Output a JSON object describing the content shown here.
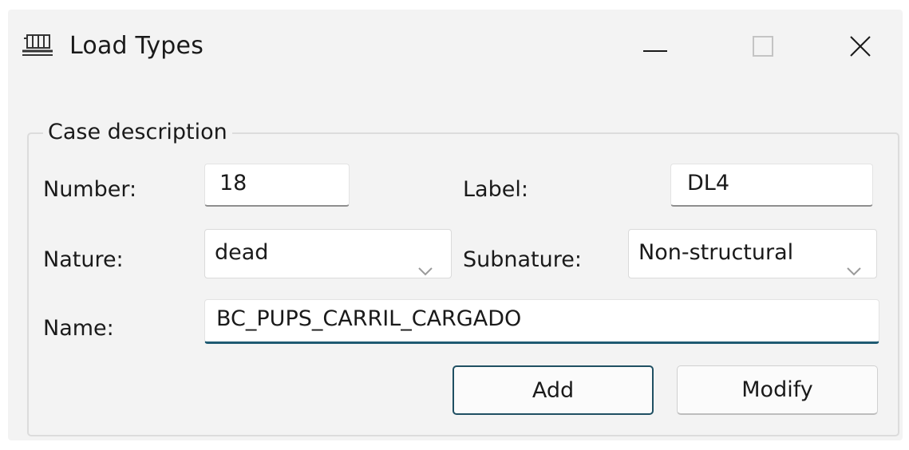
{
  "window": {
    "title": "Load Types",
    "icon": "load-types-icon",
    "controls": {
      "minimize_icon": "minimize-icon",
      "maximize_icon": "maximize-icon",
      "close_icon": "close-icon"
    }
  },
  "case_description": {
    "group_title": "Case description",
    "number": {
      "label": "Number:",
      "value": "18"
    },
    "label_field": {
      "label": "Label:",
      "value": "DL4"
    },
    "nature": {
      "label": "Nature:",
      "selected": "dead"
    },
    "subnature": {
      "label": "Subnature:",
      "selected": "Non-structural"
    },
    "name": {
      "label": "Name:",
      "value": "BC_PUPS_CARRIL_CARGADO"
    }
  },
  "buttons": {
    "add": "Add",
    "modify": "Modify"
  },
  "colors": {
    "window_bg": "#f3f3f3",
    "focus_underline": "#1e5a72",
    "primary_border": "#1f4f62"
  }
}
